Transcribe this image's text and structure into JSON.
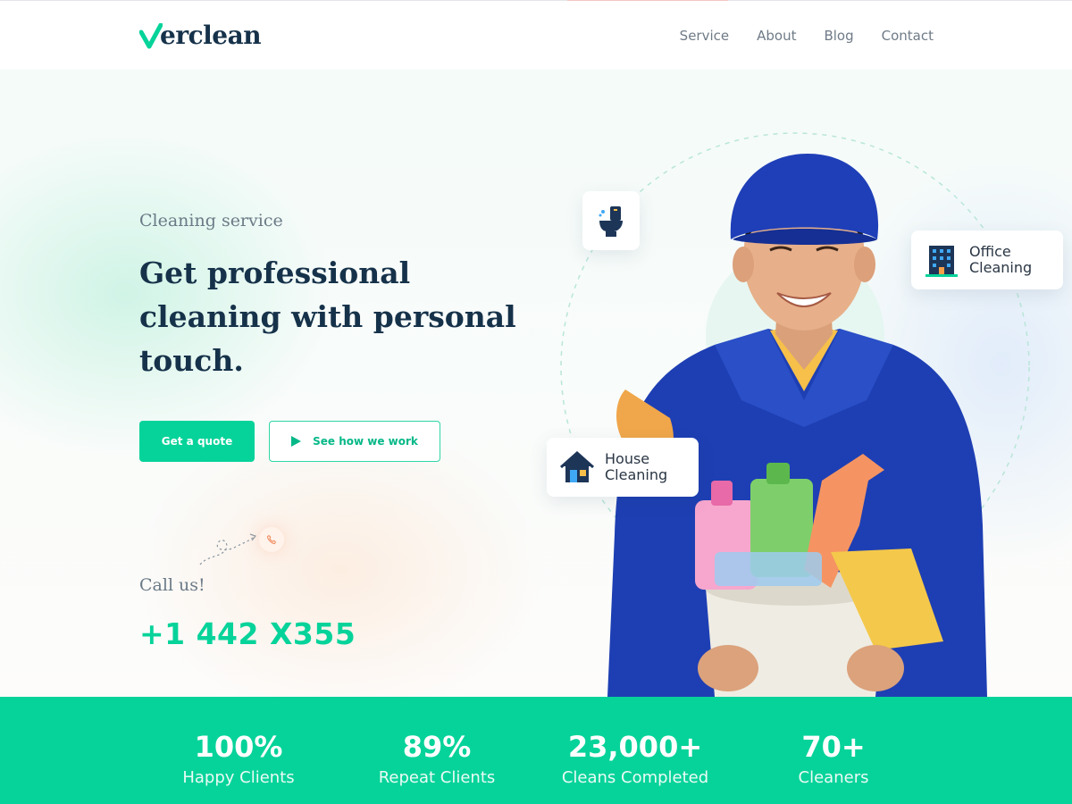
{
  "brand": {
    "name": "Verclean",
    "check_mark": "V",
    "rest": "erclean",
    "accent_color": "#06d39a",
    "dark_color": "#16324a"
  },
  "nav": {
    "items": [
      {
        "label": "Service"
      },
      {
        "label": "About"
      },
      {
        "label": "Blog"
      },
      {
        "label": "Contact"
      }
    ]
  },
  "hero": {
    "eyebrow": "Cleaning service",
    "headline": "Get professional cleaning with personal touch.",
    "primary_button": "Get a quote",
    "secondary_button": "See how we work",
    "secondary_icon": "play-icon",
    "call_label": "Call us!",
    "phone": "+1 442 X355",
    "phone_icon": "phone-icon"
  },
  "service_cards": {
    "toilet_icon": "toilet-icon",
    "office": {
      "label_line1": "Office",
      "label_line2": "Cleaning",
      "icon": "office-building-icon"
    },
    "house": {
      "label_line1": "House",
      "label_line2": "Cleaning",
      "icon": "house-icon"
    }
  },
  "stats": [
    {
      "value": "100%",
      "label": "Happy Clients"
    },
    {
      "value": "89%",
      "label": "Repeat Clients"
    },
    {
      "value": "23,000+",
      "label": "Cleans Completed"
    },
    {
      "value": "70+",
      "label": "Cleaners"
    }
  ]
}
